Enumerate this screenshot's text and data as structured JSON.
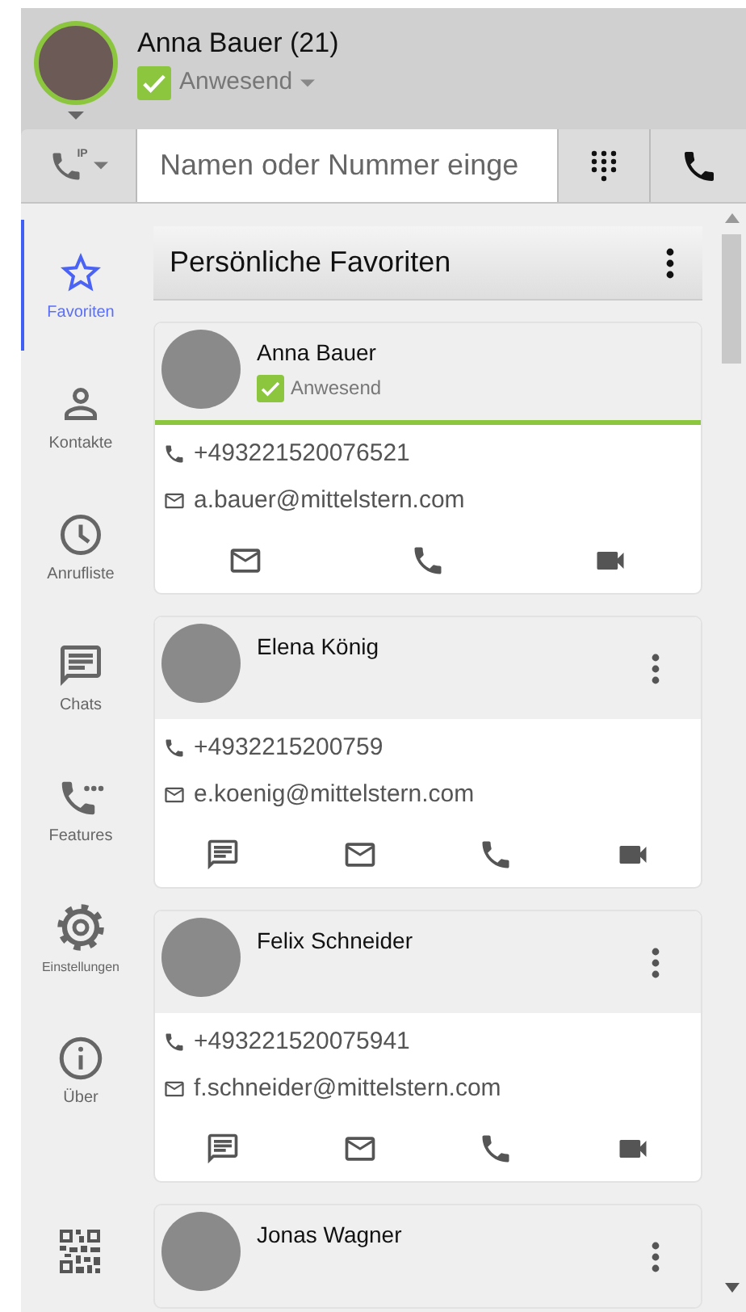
{
  "user": {
    "name": "Anna Bauer (21)",
    "presence": {
      "checked": true,
      "label": "Anwesend"
    }
  },
  "toolbar": {
    "line_mode": "IP",
    "search": {
      "placeholder": "Namen oder Nummer einge"
    }
  },
  "sidebar": {
    "items": [
      {
        "label": "Favoriten",
        "selected": true
      },
      {
        "label": "Kontakte",
        "selected": false
      },
      {
        "label": "Anrufliste",
        "selected": false
      },
      {
        "label": "Chats",
        "selected": false
      },
      {
        "label": "Features",
        "selected": false
      },
      {
        "label": "Einstellungen",
        "selected": false
      },
      {
        "label": "Über",
        "selected": false
      }
    ]
  },
  "favorites": {
    "title": "Persönliche Favoriten",
    "contacts": [
      {
        "name": "Anna Bauer",
        "presence": {
          "checked": true,
          "label": "Anwesend"
        },
        "menu": false,
        "phone": "+493221520076521",
        "email": "a.bauer@mittelstern.com",
        "actions": [
          {
            "kind": "mail"
          },
          {
            "kind": "phone"
          },
          {
            "kind": "video"
          }
        ]
      },
      {
        "name": "Elena König",
        "menu": true,
        "phone": "+4932215200759",
        "email": "e.koenig@mittelstern.com",
        "actions": [
          {
            "kind": "chat"
          },
          {
            "kind": "mail"
          },
          {
            "kind": "phone"
          },
          {
            "kind": "video"
          }
        ]
      },
      {
        "name": "Felix Schneider",
        "menu": true,
        "phone": "+493221520075941",
        "email": "f.schneider@mittelstern.com",
        "actions": [
          {
            "kind": "chat"
          },
          {
            "kind": "mail"
          },
          {
            "kind": "phone"
          },
          {
            "kind": "video"
          }
        ]
      },
      {
        "name": "Jonas Wagner",
        "menu": true
      }
    ]
  }
}
